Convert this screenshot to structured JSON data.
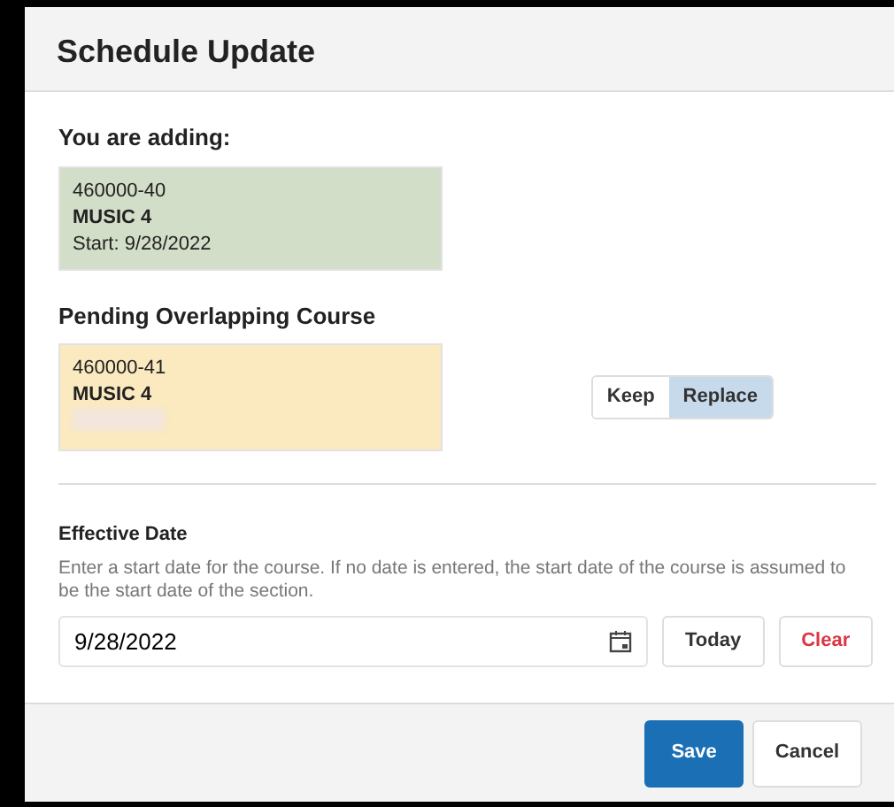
{
  "dialog": {
    "title": "Schedule Update"
  },
  "adding": {
    "heading": "You are adding:",
    "course_number": "460000-40",
    "course_name": "MUSIC 4",
    "start": "Start: 9/28/2022"
  },
  "pending": {
    "heading": "Pending Overlapping Course",
    "course_number": "460000-41",
    "course_name": "MUSIC 4",
    "redacted": true
  },
  "choice": [
    {
      "label": "Keep",
      "selected": false
    },
    {
      "label": "Replace",
      "selected": true
    }
  ],
  "effective_date": {
    "label": "Effective Date",
    "help": "Enter a start date for the course. If no date is entered, the start date of the course is assumed to be the start date of the section.",
    "value": "9/28/2022"
  },
  "date_buttons": [
    {
      "label": "Today",
      "kind": "plain"
    },
    {
      "label": "Clear",
      "kind": "danger"
    }
  ],
  "footer_buttons": [
    {
      "label": "Save",
      "kind": "primary"
    },
    {
      "label": "Cancel",
      "kind": "plain"
    }
  ]
}
